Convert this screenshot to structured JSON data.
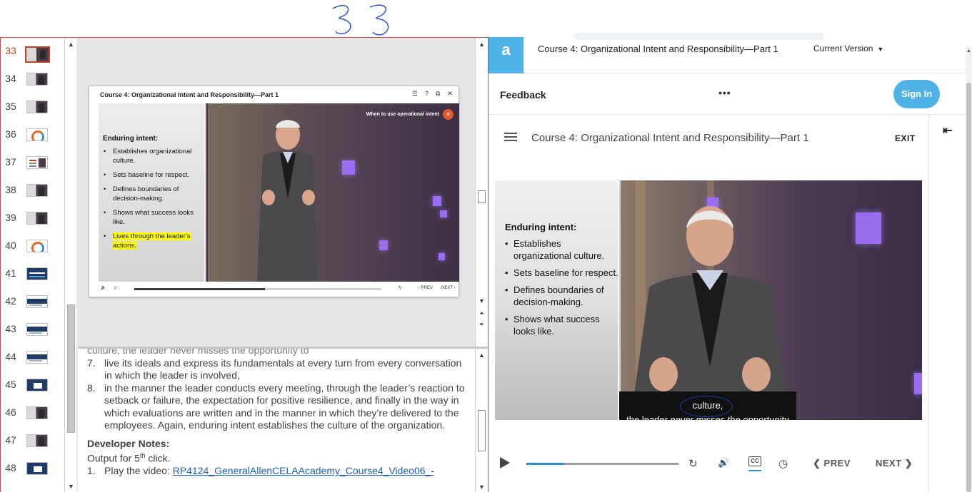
{
  "annotation": {
    "handwritten": "33"
  },
  "ppt": {
    "thumbnails": [
      {
        "num": "33",
        "kind": "video",
        "active": true
      },
      {
        "num": "34",
        "kind": "video"
      },
      {
        "num": "35",
        "kind": "video"
      },
      {
        "num": "36",
        "kind": "chart"
      },
      {
        "num": "37",
        "kind": "mini"
      },
      {
        "num": "38",
        "kind": "video"
      },
      {
        "num": "39",
        "kind": "video"
      },
      {
        "num": "40",
        "kind": "chart"
      },
      {
        "num": "41",
        "kind": "blue"
      },
      {
        "num": "42",
        "kind": "white-blue"
      },
      {
        "num": "43",
        "kind": "white-blue"
      },
      {
        "num": "44",
        "kind": "white-blue"
      },
      {
        "num": "45",
        "kind": "navy-box"
      },
      {
        "num": "46",
        "kind": "video"
      },
      {
        "num": "47",
        "kind": "video"
      },
      {
        "num": "48",
        "kind": "navy-box"
      }
    ],
    "slide": {
      "title": "Course 4: Organizational Intent and Responsibility—Part 1",
      "window_icons": [
        "☰",
        "?",
        "⧉",
        "✕"
      ],
      "tag": "When to use operational intent",
      "close_x": "✕",
      "heading": "Enduring intent:",
      "bullets": [
        "Establishes organizational culture.",
        "Sets baseline for respect.",
        "Defines boundaries of decision-making.",
        "Shows what success looks like.",
        "Lives through the leader's actions."
      ],
      "highlight_index": 4,
      "controls": {
        "prev": "PREV",
        "next": "NEXT",
        "progress": 0.53
      }
    },
    "notes": {
      "cut_line": "culture, the leader never misses the opportunity to",
      "items": [
        {
          "n": "7.",
          "text": "live its ideals and express its fundamentals at every turn from every conversation in which the leader is involved,"
        },
        {
          "n": "8.",
          "text": "in the manner the leader conducts every meeting, through the leader’s reaction to setback or failure, the expectation for positive resilience, and finally in the way in which evaluations are written and in the manner in which they’re delivered to the employees. Again, enduring intent establishes the culture of the organization."
        }
      ],
      "dev_heading": "Developer Notes:",
      "output_prefix": "Output for 5",
      "output_sup": "th",
      "output_suffix": " click.",
      "play_item_n": "1.",
      "play_item_text": "Play the video: ",
      "play_item_link": "RP4124_GeneralAllenCELAAcademy_Course4_Video06_-"
    }
  },
  "web": {
    "logo_letter": "a",
    "course_title": "Course 4: Organizational Intent and Responsibility—Part 1",
    "version": "Current Version",
    "feedback": "Feedback",
    "more": "•••",
    "signin": "Sign In",
    "collapse": "⇤",
    "player": {
      "title": "Course 4: Organizational Intent and Responsibility—Part 1",
      "exit": "EXIT",
      "heading": "Enduring intent:",
      "bullets": [
        "Establishes organizational culture.",
        "Sets baseline for respect.",
        "Defines boundaries of decision-making.",
        "Shows what success looks like."
      ],
      "caption_line1": "culture,",
      "caption_line2": "the leader never misses the opportunity",
      "progress": 0.25,
      "replay": "↻",
      "volume": "🔊",
      "cc": "CC",
      "speed": "◷",
      "prev": "PREV",
      "next": "NEXT"
    }
  }
}
